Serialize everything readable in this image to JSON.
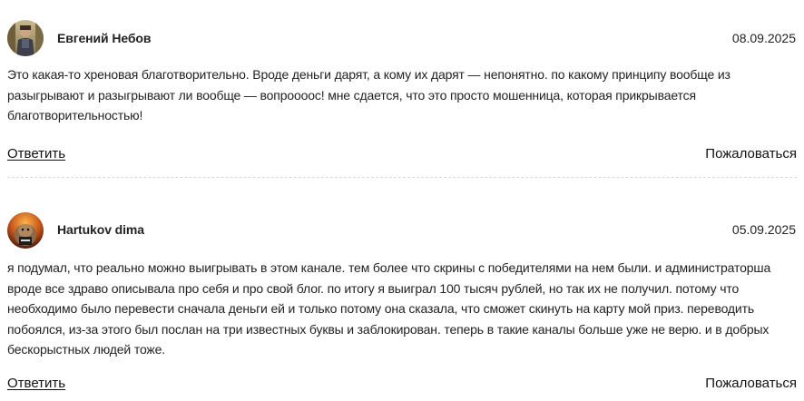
{
  "comments": [
    {
      "author": "Евгений Небов",
      "date": "08.09.2025",
      "text": "Это какая-то хреновая благотворительно. Вроде деньги дарят, а кому их дарят — непонятно. по какому принципу вообще из разыгрывают и разыгрывают ли вообще — вопроооос! мне сдается, что это просто мошенница, которая прикрывается благотворительностью!",
      "reply_label": "Ответить",
      "report_label": "Пожаловаться",
      "avatar_icon": "user-photo-avatar"
    },
    {
      "author": "Hartukov dima",
      "date": "05.09.2025",
      "text": "я подумал, что реально можно выигрывать в этом канале. тем более что скрины с победителями на нем были. и администраторша вроде все здраво описывала про себя и про свой блог. по итогу я выиграл 100 тысяч рублей, но так их не получил. потому что необходимо было перевести сначала деньги ей и только потому она сказала, что сможет скинуть на карту мой приз. переводить побоялся, из-за этого был послан на три известных буквы и заблокирован. теперь в такие каналы больше уже не верю. и в добрых бескорыстных людей тоже.",
      "reply_label": "Ответить",
      "report_label": "Пожаловаться",
      "avatar_icon": "hamster-photo-avatar"
    }
  ]
}
